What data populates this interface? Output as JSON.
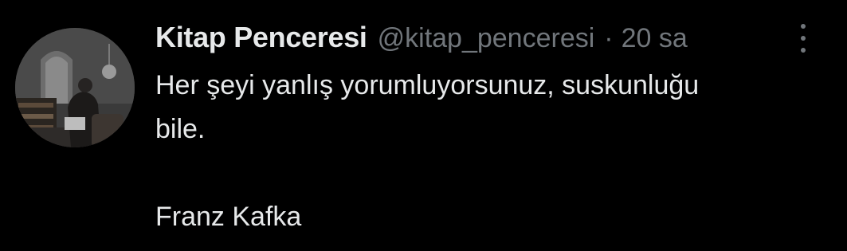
{
  "tweet": {
    "display_name": "Kitap Penceresi",
    "handle": "@kitap_penceresi",
    "separator": "·",
    "time": "20 sa",
    "text_line_1": "Her şeyi yanlış yorumluyorsunuz, suskunluğu",
    "text_line_2": "bile.",
    "text_line_3": "Franz Kafka",
    "more_icon": "more-options-vertical-icon"
  },
  "colors": {
    "background": "#000000",
    "primary_text": "#e7e9ea",
    "secondary_text": "#71767b"
  }
}
